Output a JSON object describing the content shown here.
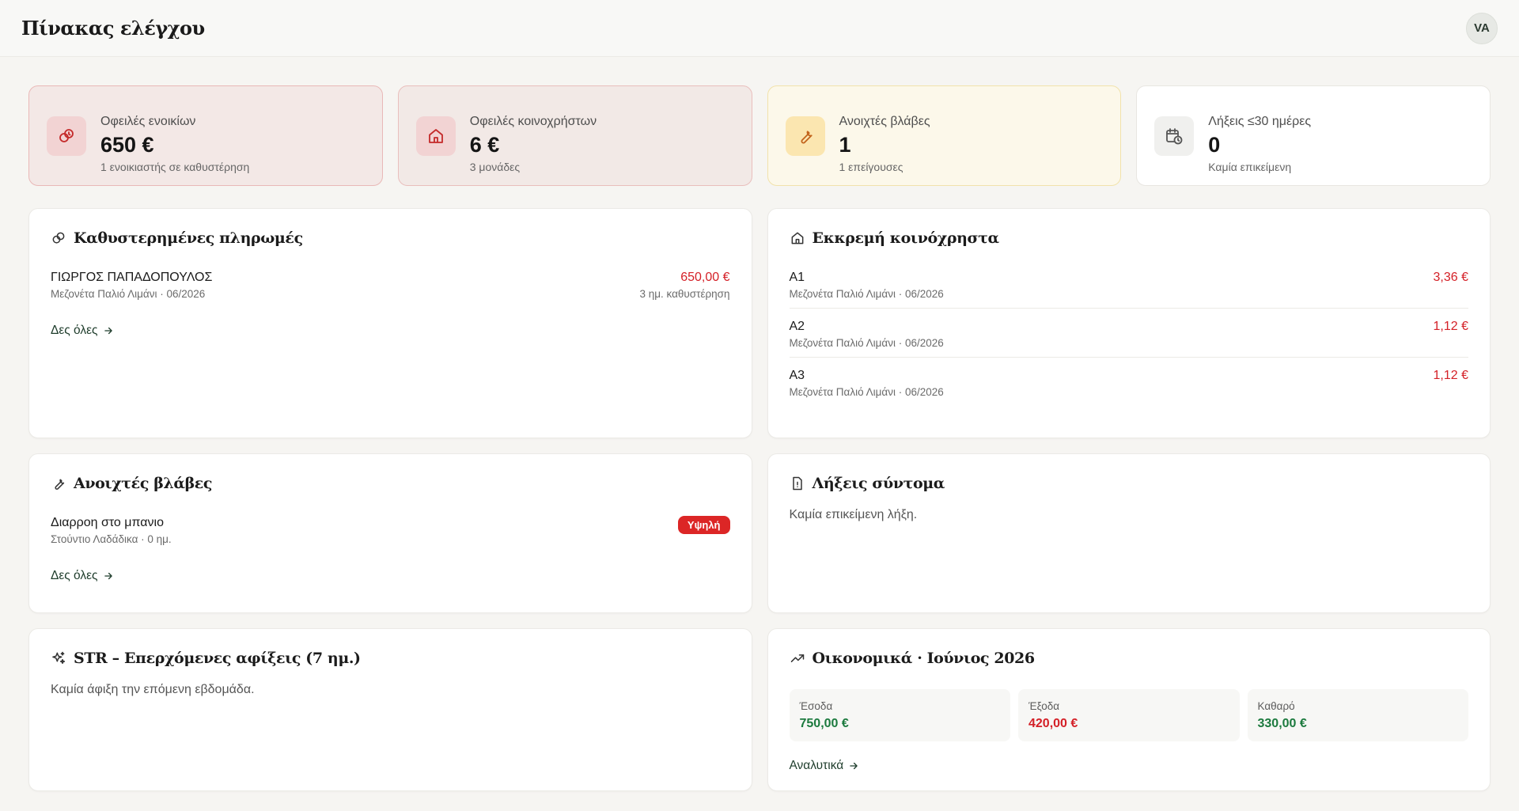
{
  "header": {
    "title": "Πίνακας ελέγχου",
    "avatar": "VA"
  },
  "stats": [
    {
      "label": "Οφειλές ενοικίων",
      "value": "650 €",
      "sub": "1 ενοικιαστής σε καθυστέρηση",
      "icon": "overdue-money-icon"
    },
    {
      "label": "Οφειλές κοινοχρήστων",
      "value": "6 €",
      "sub": "3 μονάδες",
      "icon": "home-icon"
    },
    {
      "label": "Ανοιχτές βλάβες",
      "value": "1",
      "sub": "1 επείγουσες",
      "icon": "wrench-icon"
    },
    {
      "label": "Λήξεις ≤30 ημέρες",
      "value": "0",
      "sub": "Καμία επικείμενη",
      "icon": "calendar-clock-icon"
    }
  ],
  "late_payments": {
    "title": "Καθυστερημένες πληρωμές",
    "items": [
      {
        "name": "ΓΙΩΡΓΟΣ ΠΑΠΑΔΟΠΟΥΛΟΣ",
        "meta": "Μεζονέτα Παλιό Λιμάνι · 06/2026",
        "amount": "650,00 €",
        "delay": "3 ημ. καθυστέρηση"
      }
    ],
    "see_all": "Δες όλες"
  },
  "pending_common": {
    "title": "Εκκρεμή κοινόχρηστα",
    "items": [
      {
        "unit": "A1",
        "meta": "Μεζονέτα Παλιό Λιμάνι · 06/2026",
        "amount": "3,36 €"
      },
      {
        "unit": "A2",
        "meta": "Μεζονέτα Παλιό Λιμάνι · 06/2026",
        "amount": "1,12 €"
      },
      {
        "unit": "A3",
        "meta": "Μεζονέτα Παλιό Λιμάνι · 06/2026",
        "amount": "1,12 €"
      }
    ]
  },
  "open_issues": {
    "title": "Ανοιχτές βλάβες",
    "items": [
      {
        "name": "Διαρροη στο μπανιο",
        "meta": "Στούντιο Λαδάδικα · 0 ημ.",
        "priority": "Υψηλή"
      }
    ],
    "see_all": "Δες όλες"
  },
  "expirations": {
    "title": "Λήξεις σύντομα",
    "empty": "Καμία επικείμενη λήξη."
  },
  "str_arrivals": {
    "title": "STR – Επερχόμενες αφίξεις (7 ημ.)",
    "empty": "Καμία άφιξη την επόμενη εβδομάδα."
  },
  "finance": {
    "title": "Οικονομικά · Ιούνιος 2026",
    "income_label": "Έσοδα",
    "income": "750,00 €",
    "expense_label": "Έξοδα",
    "expense": "420,00 €",
    "net_label": "Καθαρό",
    "net": "330,00 €",
    "details": "Αναλυτικά"
  },
  "colors": {
    "accent_red": "#d42027",
    "accent_green": "#1c7a3e",
    "badge_red": "#dc2626"
  }
}
